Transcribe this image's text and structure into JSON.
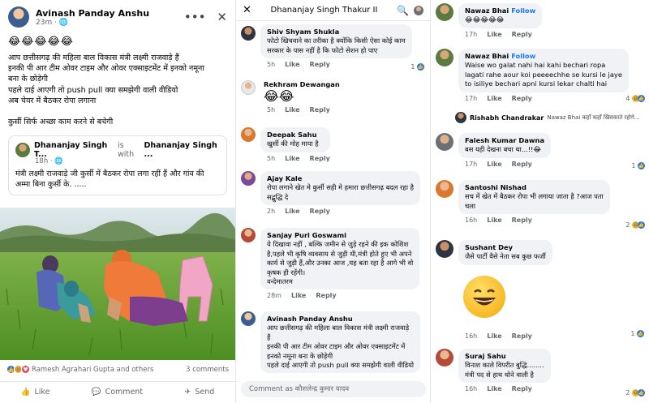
{
  "post": {
    "author": "Avinash Panday Anshu",
    "time": "23m ·",
    "emojis": "😂😂😂😂😂",
    "lines": [
      "आप छत्तीसगढ़ की महिला बाल विकास मंत्री लक्ष्मी राजवाड़े हैं",
      "इनकी पी आर टीम ओवर टाइम और ओवर एक्साइटमेंट में इनको नमूना",
      "बना के छोड़ेगी",
      "पहले दाई आएगी तो push pull क्या समझेगी वाली वीडियो",
      "अब चेयर में बैठकर रोपा लगाना",
      "",
      "कुर्सी सिर्फ अच्छा काम करने से बचेगी"
    ],
    "shared": {
      "author": "Dhananjay Singh T...",
      "with_text": "is with",
      "with_name": "Dhananjay Singh ...",
      "time": "18h ·",
      "text1": "मंत्री लक्ष्मी राजवाड़े जी कुर्सी में बैठकर रोपा लगा रहीं हैं और गांव की",
      "text2": "अम्मा बिना कुर्सी के. ....."
    },
    "reactions_text": "Ramesh Agrahari Gupta and others",
    "comments_count": "3 comments",
    "actions": {
      "like": "Like",
      "comment": "Comment",
      "send": "Send"
    }
  },
  "comments_panel": {
    "title": "Dhananjay Singh Thakur II",
    "input_placeholder": "Comment as कौशलेन्द्र कुमार यादव",
    "comments": [
      {
        "name": "Shiv Shyam Shukla",
        "lines": [
          "फोटो खिचवाने का तरीका है क्योंकि किसी ऐसा कोई काम",
          "सरकार के पास नहीं है कि फोटो सेशन हो पाए"
        ],
        "time": "5h",
        "count": "1"
      },
      {
        "name": "Rekhram Dewangan",
        "lines": [
          "😂😂"
        ],
        "time": "5h"
      },
      {
        "name": "Deepak Sahu",
        "lines": [
          "खुर्सी की मोह माया है"
        ],
        "time": "5h"
      },
      {
        "name": "Ajay Kale",
        "lines": [
          "रोपा लगाने खेत मे कुर्सी सही मे हमारा छत्तीसगढ़ बदल रहा है",
          "सद्बुद्धि दे"
        ],
        "time": "2h"
      },
      {
        "name": "Sanjay Puri Goswami",
        "lines": [
          "ये दिखावा नहीं , बल्कि जमीन से जुड़े रहने की इक कोशिश",
          "है,पहले भी कृषि व्यवसाय से जुड़ी थी,मंत्री होते हुए भी अपने",
          "कार्य से जुड़ी हैं,और उनका आज ,यह बता रहा है आगे भी वो",
          "कृषक ही रहेंगी।",
          "वन्देमातरम"
        ],
        "time": "28m"
      },
      {
        "name": "Avinash Panday Anshu",
        "lines": [
          "आप छत्तीसगढ़ की महिला बाल विकास मंत्री लक्ष्मी राजवाड़े",
          "हैं",
          "इनकी पी आर टीम ओवर टाइम और ओवर एक्साइटमेंट में",
          "इनको नमूना बना के छोड़ेगी",
          "पहले दाई आएगी तो push pull क्या समझेगी वाली वीडियो"
        ]
      }
    ],
    "like": "Like",
    "reply": "Reply"
  },
  "replies_panel": {
    "follow": "Follow",
    "like": "Like",
    "reply": "Reply",
    "items": [
      {
        "name": "Nawaz Bhai",
        "lines": [
          "😂😂😂😂😂"
        ],
        "time": "17h"
      },
      {
        "name": "Nawaz Bhai",
        "lines": [
          "Waise wo galat nahi hai kahi bechari ropa",
          "lagati rahe aour koi peeeechhe se kursi le jaye",
          "to isiliye bechari apni kursi lekar chalti hai"
        ],
        "time": "17h",
        "count": "4"
      },
      {
        "name": "Rishabh Chandrakar",
        "reply_text": "Nawaz Bhai कहाँ कहाँ खिसकाते रहोगे..."
      },
      {
        "name": "Falesh Kumar Dawna",
        "lines": [
          "बस यही देखना बचा था...!!😂"
        ],
        "time": "17h",
        "count": "1"
      },
      {
        "name": "Santoshi Nishad",
        "lines": [
          "सच में खेत में बैठकर रोपा भी लगाया जाता है ?आज पता",
          "चला"
        ],
        "time": "16h",
        "count": "2"
      },
      {
        "name": "Sushant Dey",
        "lines": [
          "जैसे पार्टी वैसे नेता सब कुछ फर्जी"
        ]
      },
      {
        "time": "16h",
        "count": "1"
      },
      {
        "name": "Suraj Sahu",
        "lines": [
          "विनाश काले विपरीत बुद्धि........",
          "मंत्री पद से हाथ धोने वाली है"
        ],
        "time": "16h",
        "count": "2"
      }
    ]
  }
}
